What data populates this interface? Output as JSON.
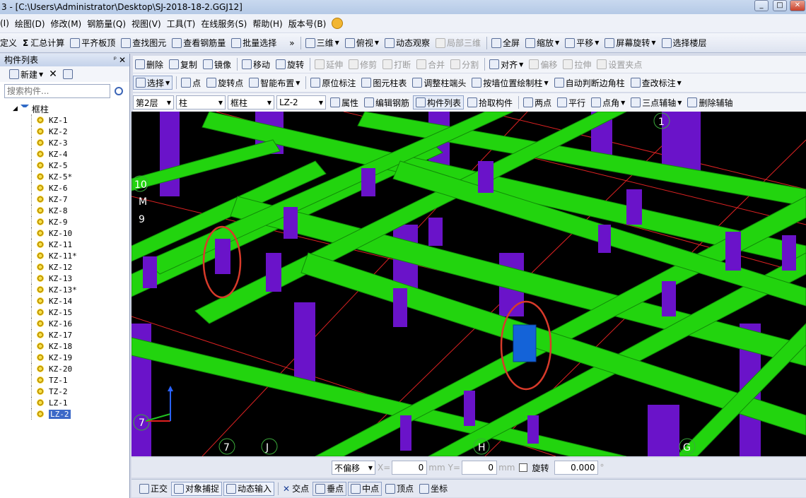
{
  "window": {
    "title": "3 - [C:\\Users\\Administrator\\Desktop\\SJ-2018-18-2.GGJ12]",
    "btn_min": "_",
    "btn_max": "□",
    "btn_close": "✕"
  },
  "menu": {
    "items": [
      "(I)",
      "绘图(D)",
      "修改(M)",
      "钢筋量(Q)",
      "视图(V)",
      "工具(T)",
      "在线服务(S)",
      "帮助(H)",
      "版本号(B)"
    ]
  },
  "toolbar1": {
    "define": "定义",
    "sum": "汇总计算",
    "align_slab": "平齐板顶",
    "find": "查找图元",
    "view_rebar": "查看钢筋量",
    "batch_select": "批量选择",
    "overflow": "»",
    "view3d": "三维",
    "top_view": "俯视",
    "dynamic": "动态观察",
    "local3d": "局部三维",
    "fullscreen": "全屏",
    "zoom": "缩放",
    "pan": "平移",
    "screen_rotate": "屏幕旋转",
    "select_floor": "选择楼层"
  },
  "panel": {
    "title": "构件列表",
    "pin": "ᵖ",
    "close": "✕",
    "new_label": "新建",
    "search_placeholder": "搜索构件...",
    "root": "框柱",
    "items": [
      "KZ-1",
      "KZ-2",
      "KZ-3",
      "KZ-4",
      "KZ-5",
      "KZ-5*",
      "KZ-6",
      "KZ-7",
      "KZ-8",
      "KZ-9",
      "KZ-10",
      "KZ-11",
      "KZ-11*",
      "KZ-12",
      "KZ-13",
      "KZ-13*",
      "KZ-14",
      "KZ-15",
      "KZ-16",
      "KZ-17",
      "KZ-18",
      "KZ-19",
      "KZ-20",
      "TZ-1",
      "TZ-2",
      "LZ-1",
      "LZ-2"
    ],
    "selected_index": 26
  },
  "toolbar2": {
    "delete": "删除",
    "copy": "复制",
    "mirror": "镜像",
    "move": "移动",
    "rotate": "旋转",
    "extend": "延伸",
    "trim": "修剪",
    "break": "打断",
    "merge": "合并",
    "split": "分割",
    "align": "对齐",
    "offset": "偏移",
    "stretch": "拉伸",
    "set_point": "设置夹点"
  },
  "toolbar3": {
    "select": "选择",
    "point": "点",
    "rotate_point": "旋转点",
    "smart_layout": "智能布置",
    "original_label": "原位标注",
    "column_table": "图元柱表",
    "adjust_column_end": "调整柱端头",
    "wall_column": "按墙位置绘制柱",
    "auto_corner": "自动判断边角柱",
    "edit_label": "查改标注"
  },
  "toolbar4": {
    "floor": "第2层",
    "category": "柱",
    "type": "框柱",
    "component": "LZ-2",
    "property": "属性",
    "edit_rebar": "编辑钢筋",
    "comp_list": "构件列表",
    "pick": "拾取构件",
    "two_points": "两点",
    "parallel": "平行",
    "point_angle": "点角",
    "three_point_axis": "三点辅轴",
    "del_axis": "删除辅轴"
  },
  "viewport": {
    "axis_labels": [
      "10",
      "M",
      "9",
      "1",
      "7",
      "J",
      "H",
      "G",
      "7"
    ]
  },
  "statusbar": {
    "offset_mode": "不偏移",
    "x_label": "X=",
    "x_value": "0",
    "unit1": "mm",
    "y_label": "Y=",
    "y_value": "0",
    "unit2": "mm",
    "rotate_label": "旋转",
    "rotate_value": "0.000",
    "degree": "°"
  },
  "snapbar": {
    "ortho": "正交",
    "obj_snap": "对象捕捉",
    "dyn_input": "动态输入",
    "intersection": "交点",
    "perpendicular": "垂点",
    "midpoint": "中点",
    "vertex": "顶点",
    "coordinate": "坐标"
  },
  "colors": {
    "beam_green": "#22d40e",
    "column_purple": "#6a13c9",
    "selected_blue": "#1463d8",
    "highlight_red": "#d83a2a"
  }
}
